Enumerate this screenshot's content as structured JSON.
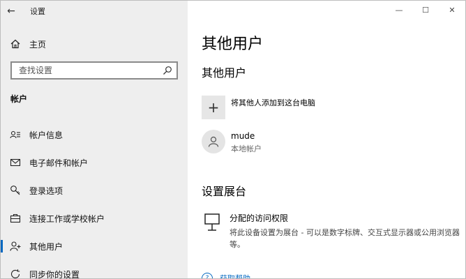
{
  "window": {
    "title": "设置",
    "controls": {
      "minimize": "—",
      "maximize": "☐",
      "close": "✕"
    }
  },
  "sidebar": {
    "home_label": "主页",
    "search_placeholder": "查找设置",
    "section_title": "帐户",
    "items": [
      {
        "label": "帐户信息",
        "icon": "account-info-icon"
      },
      {
        "label": "电子邮件和帐户",
        "icon": "mail-icon"
      },
      {
        "label": "登录选项",
        "icon": "key-icon"
      },
      {
        "label": "连接工作或学校帐户",
        "icon": "briefcase-icon"
      },
      {
        "label": "其他用户",
        "icon": "add-person-icon",
        "active": true
      },
      {
        "label": "同步你的设置",
        "icon": "sync-icon"
      }
    ]
  },
  "main": {
    "title": "其他用户",
    "other_users_heading": "其他用户",
    "add_user_label": "将其他人添加到这台电脑",
    "users": [
      {
        "name": "mude",
        "type": "本地帐户"
      }
    ],
    "kiosk_heading": "设置展台",
    "kiosk_title": "分配的访问权限",
    "kiosk_description": "将此设备设置为展台 - 可以是数字标牌、交互式显示器或公用浏览器等。",
    "help_link": "获取帮助"
  },
  "colors": {
    "accent": "#0067c0",
    "sidebar_bg": "#eeeeee"
  }
}
